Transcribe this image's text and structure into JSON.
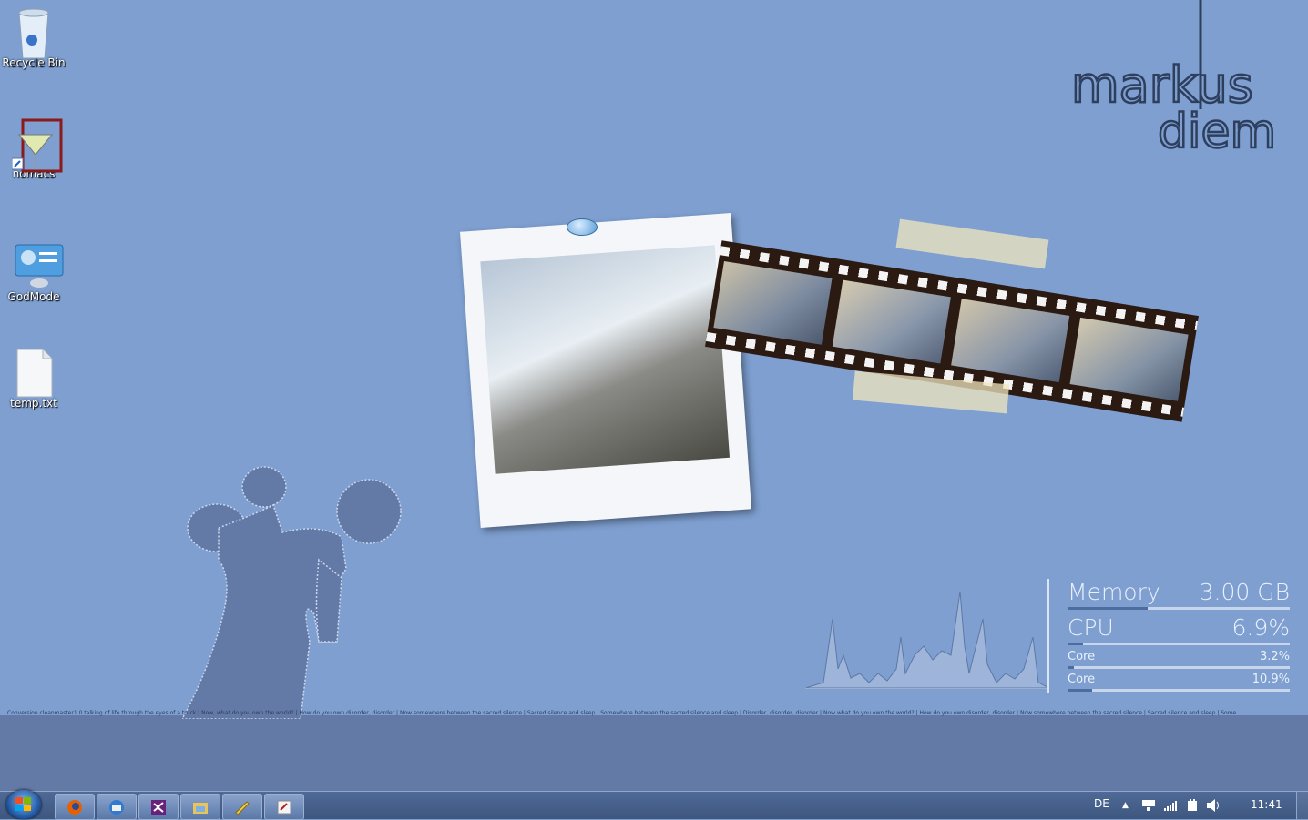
{
  "desktop_icons": [
    {
      "label": "Recycle Bin",
      "icon": "recycle-bin-icon"
    },
    {
      "label": "nomacs",
      "icon": "nomacs-icon"
    },
    {
      "label": "GodMode",
      "icon": "godmode-icon"
    },
    {
      "label": "temp.txt",
      "icon": "text-file-icon"
    }
  ],
  "logo": {
    "line1": "markus",
    "line2": "diem"
  },
  "meters": {
    "memory_label": "Memory",
    "memory_value": "3.00 GB",
    "memory_fraction": 0.48,
    "cpu_label": "CPU",
    "cpu_value": "6.9%",
    "cpu_fraction": 0.069,
    "core1_label": "Core",
    "core1_value": "3.2%",
    "core1_fraction": 0.032,
    "core2_label": "Core",
    "core2_value": "10.9%",
    "core2_fraction": 0.109
  },
  "ticker": "Conversion cleanmaster1.0 talking of life through the eyes of a truck | Now, what do you own the world? | How do you own disorder, disorder | Now somewhere between the sacred silence | Sacred silence and sleep | Somewhere between the sacred silence and sleep | Disorder, disorder, disorder | Now what do you own the world? | How do you own disorder, disorder | Now somewhere between the sacred silence | Sacred silence and sleep | Some",
  "taskbar": {
    "apps": [
      "firefox-icon",
      "thunderbird-icon",
      "visual-studio-icon",
      "explorer-icon",
      "tool-icon",
      "editor-icon"
    ],
    "language": "DE",
    "clock": "11:41"
  },
  "colors": {
    "desktop": "#7e9fd0",
    "ground": "#6379a6",
    "taskbar": "#3d577f"
  }
}
